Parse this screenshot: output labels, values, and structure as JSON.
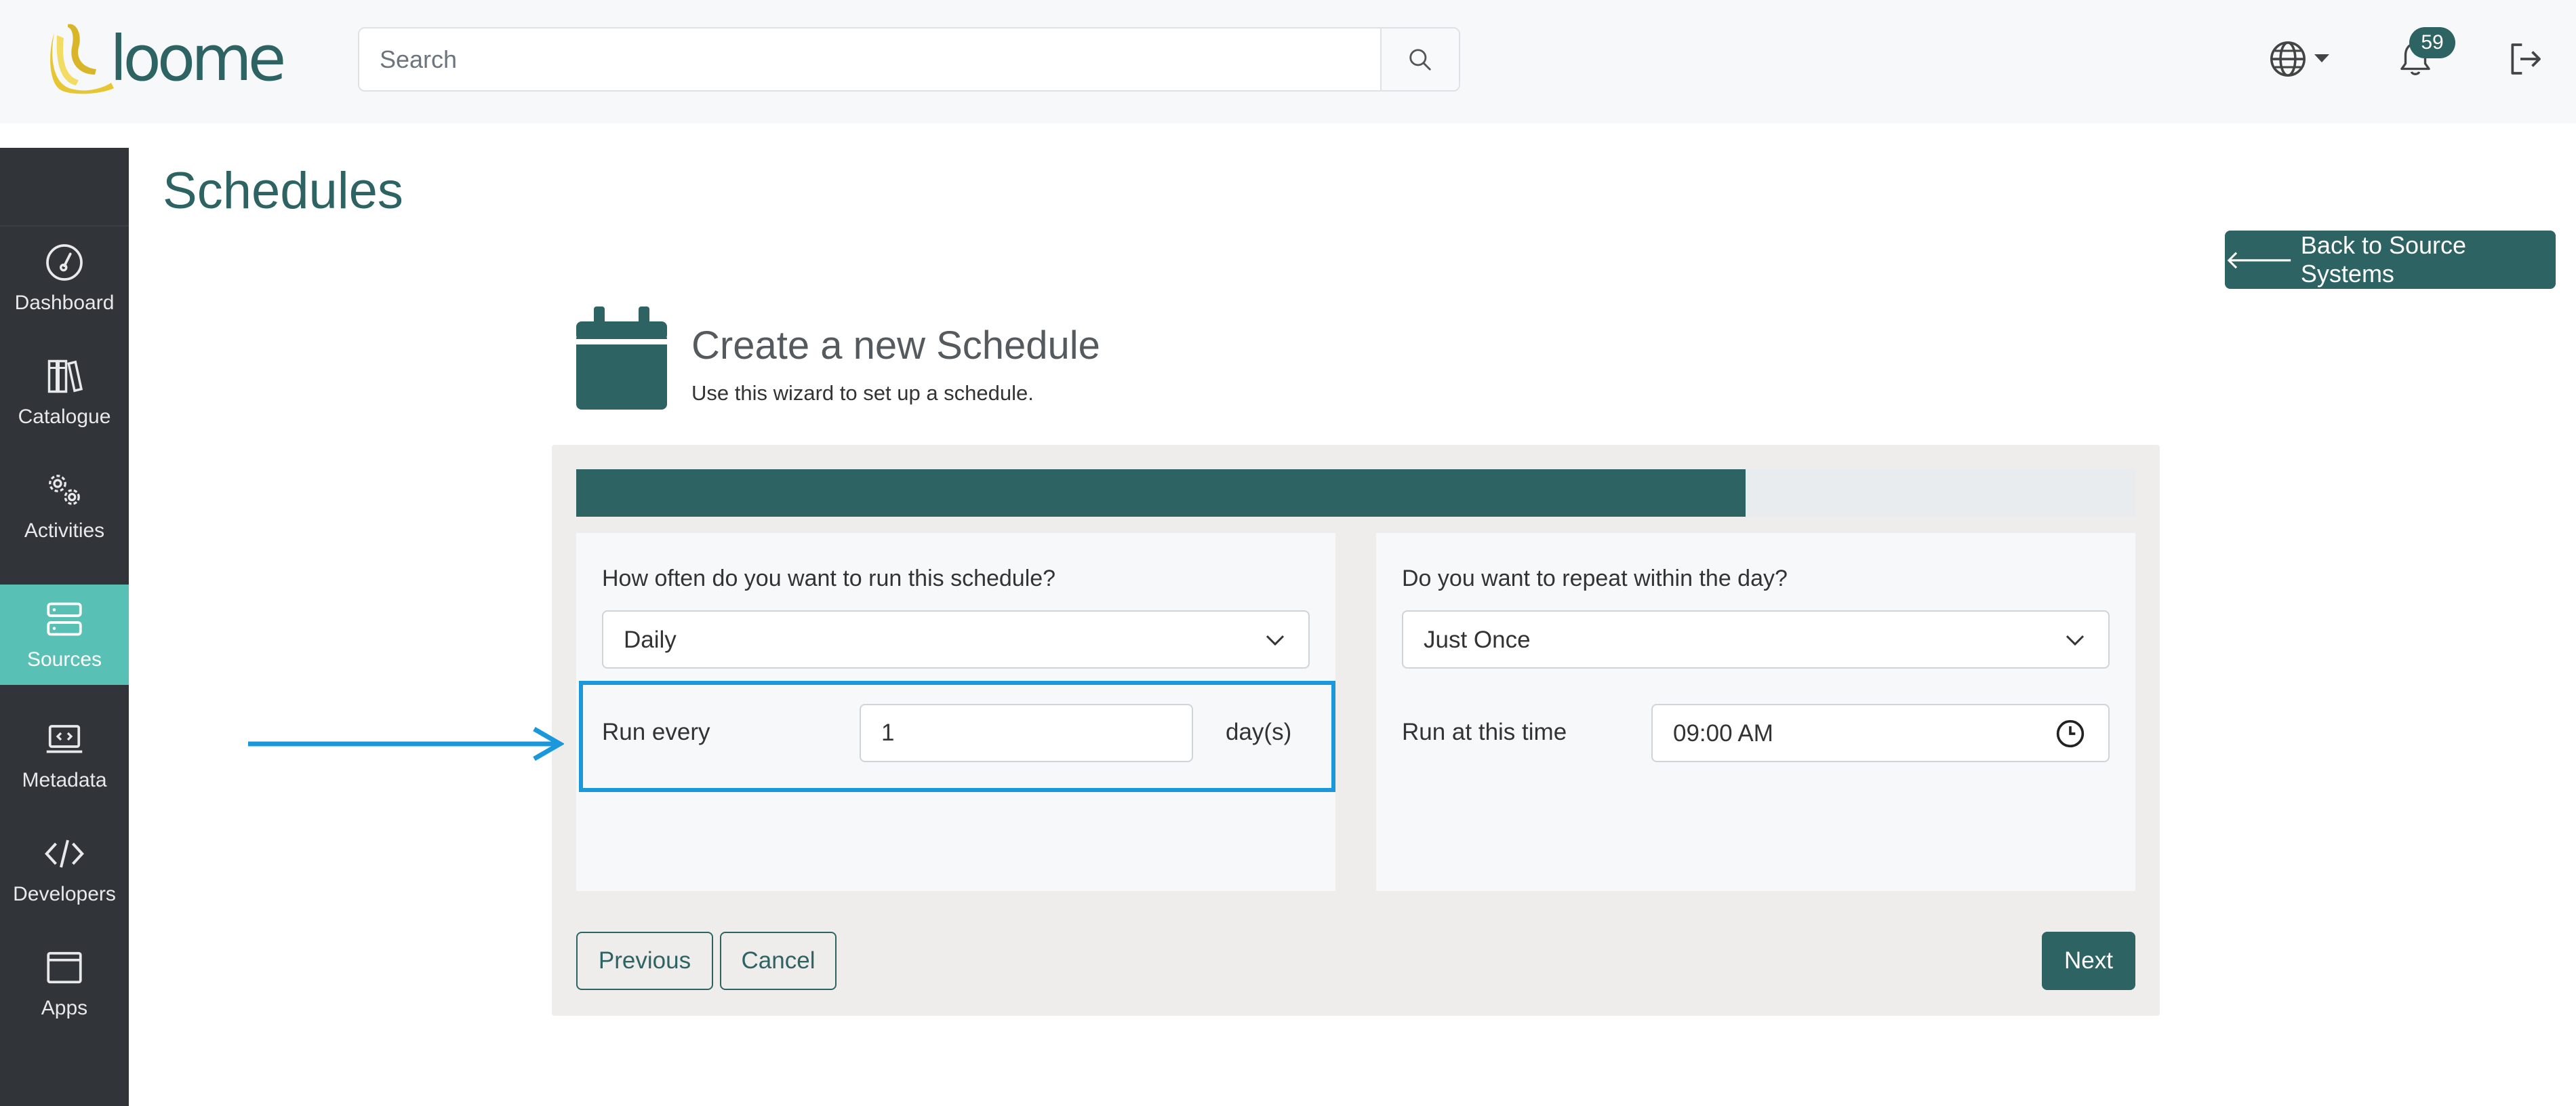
{
  "header": {
    "logo_text": "loome",
    "search": {
      "placeholder": "Search",
      "value": ""
    },
    "notifications": {
      "count": "59"
    }
  },
  "sidebar": {
    "items": [
      {
        "label": "Dashboard",
        "icon": "dashboard-icon",
        "active": false
      },
      {
        "label": "Catalogue",
        "icon": "catalogue-icon",
        "active": false
      },
      {
        "label": "Activities",
        "icon": "activities-icon",
        "active": false
      },
      {
        "label": "Sources",
        "icon": "sources-icon",
        "active": true
      },
      {
        "label": "Metadata",
        "icon": "metadata-icon",
        "active": false
      },
      {
        "label": "Developers",
        "icon": "developers-icon",
        "active": false
      },
      {
        "label": "Apps",
        "icon": "apps-icon",
        "active": false
      }
    ]
  },
  "page": {
    "title": "Schedules",
    "back_button": "Back to Source Systems"
  },
  "wizard": {
    "title": "Create a new Schedule",
    "subtitle": "Use this wizard to set up a schedule.",
    "progress": 0.75,
    "left": {
      "question": "How often do you want to run this schedule?",
      "frequency": "Daily",
      "run_every_label": "Run every",
      "run_every_value": "1",
      "unit": "day(s)"
    },
    "right": {
      "question": "Do you want to repeat within the day?",
      "repeat": "Just Once",
      "time_label": "Run at this time",
      "time_value": "09:00  AM"
    },
    "buttons": {
      "previous": "Previous",
      "cancel": "Cancel",
      "next": "Next"
    }
  },
  "colors": {
    "brand": "#2e6363",
    "accent_active": "#58c0b4",
    "sidebar_bg": "#313438",
    "annotation": "#1a98db"
  }
}
